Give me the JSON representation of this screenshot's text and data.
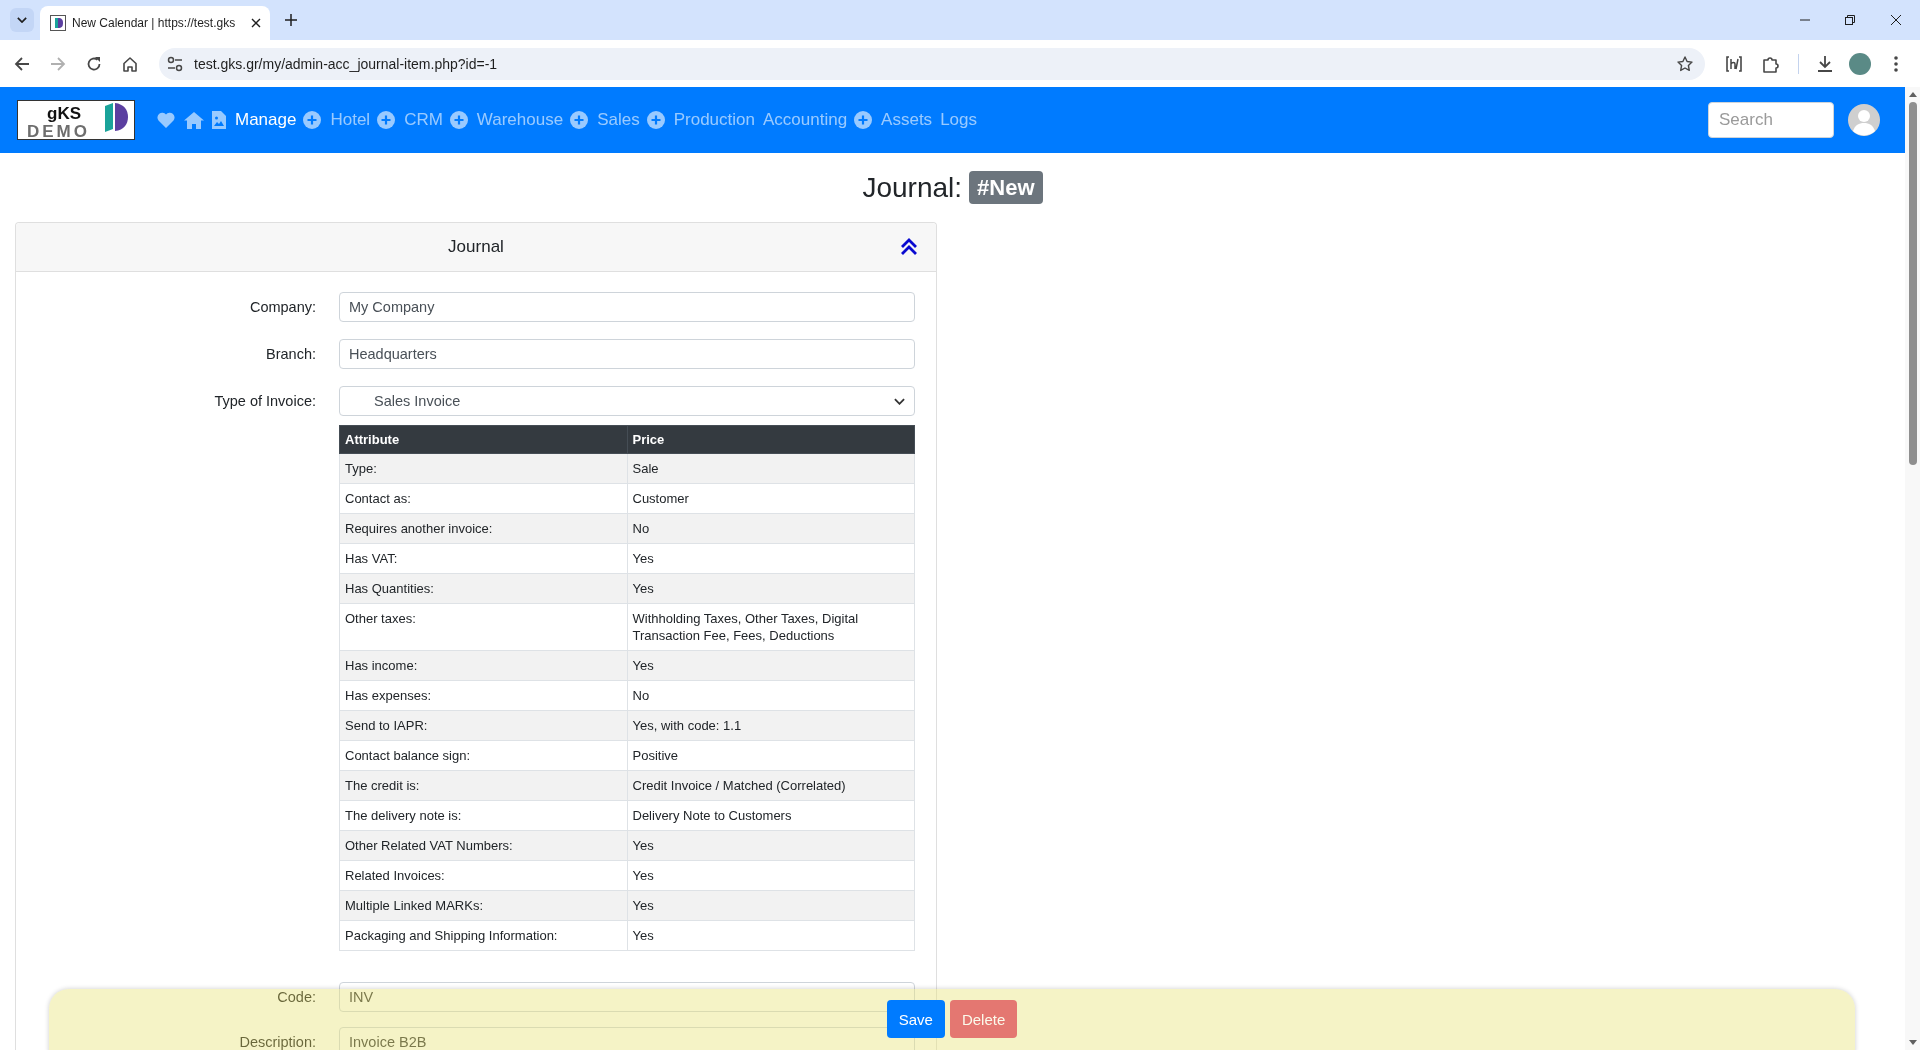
{
  "browser": {
    "tab_title": "New Calendar | https://test.gks",
    "url": "test.gks.gr/my/admin-acc_journal-item.php?id=-1",
    "forward_disabled": true
  },
  "navbar": {
    "logo": {
      "text": "gKS",
      "stamp": "DEMO"
    },
    "items": [
      {
        "label": "Manage",
        "selected": true,
        "add_button": false
      },
      {
        "label": "Hotel",
        "selected": false,
        "add_button": true
      },
      {
        "label": "CRM",
        "selected": false,
        "add_button": true
      },
      {
        "label": "Warehouse",
        "selected": false,
        "add_button": true
      },
      {
        "label": "Sales",
        "selected": false,
        "add_button": true
      },
      {
        "label": "Production",
        "selected": false,
        "add_button": true
      },
      {
        "label": "Accounting",
        "selected": false,
        "add_button": false
      },
      {
        "label": "Assets",
        "selected": false,
        "add_button": true
      },
      {
        "label": "Logs",
        "selected": false,
        "add_button": false
      }
    ],
    "search": {
      "placeholder": "Search"
    }
  },
  "page_title": {
    "text": "Journal:",
    "badge": "#New"
  },
  "card": {
    "title": "Journal",
    "expanded": true,
    "fields": [
      {
        "label": "Company:",
        "value": "My Company",
        "kind": "text"
      },
      {
        "label": "Branch:",
        "value": "Headquarters",
        "kind": "text"
      },
      {
        "label": "Type of Invoice:",
        "value": "Sales Invoice",
        "kind": "select"
      }
    ],
    "table": {
      "columns": [
        "Attribute",
        "Price"
      ],
      "rows": [
        [
          "Type:",
          "Sale"
        ],
        [
          "Contact as:",
          "Customer"
        ],
        [
          "Requires another invoice:",
          "No"
        ],
        [
          "Has VAT:",
          "Yes"
        ],
        [
          "Has Quantities:",
          "Yes"
        ],
        [
          "Other taxes:",
          "Withholding Taxes, Other Taxes, Digital Transaction Fee, Fees, Deductions"
        ],
        [
          "Has income:",
          "Yes"
        ],
        [
          "Has expenses:",
          "No"
        ],
        [
          "Send to IAPR:",
          "Yes, with code: 1.1"
        ],
        [
          "Contact balance sign:",
          "Positive"
        ],
        [
          "The credit is:",
          "Credit Invoice / Matched (Correlated)"
        ],
        [
          "The delivery note is:",
          "Delivery Note to Customers"
        ],
        [
          "Other Related VAT Numbers:",
          "Yes"
        ],
        [
          "Related Invoices:",
          "Yes"
        ],
        [
          "Multiple Linked MARKs:",
          "Yes"
        ],
        [
          "Packaging and Shipping Information:",
          "Yes"
        ]
      ]
    },
    "more_fields": [
      {
        "label": "Code:",
        "value": "INV",
        "kind": "text"
      },
      {
        "label": "Description:",
        "value": "Invoice B2B",
        "kind": "text"
      }
    ]
  },
  "action_bar": {
    "buttons": [
      {
        "label": "Save",
        "kind": "primary",
        "disabled": false
      },
      {
        "label": "Delete",
        "kind": "danger",
        "disabled": true
      }
    ]
  }
}
